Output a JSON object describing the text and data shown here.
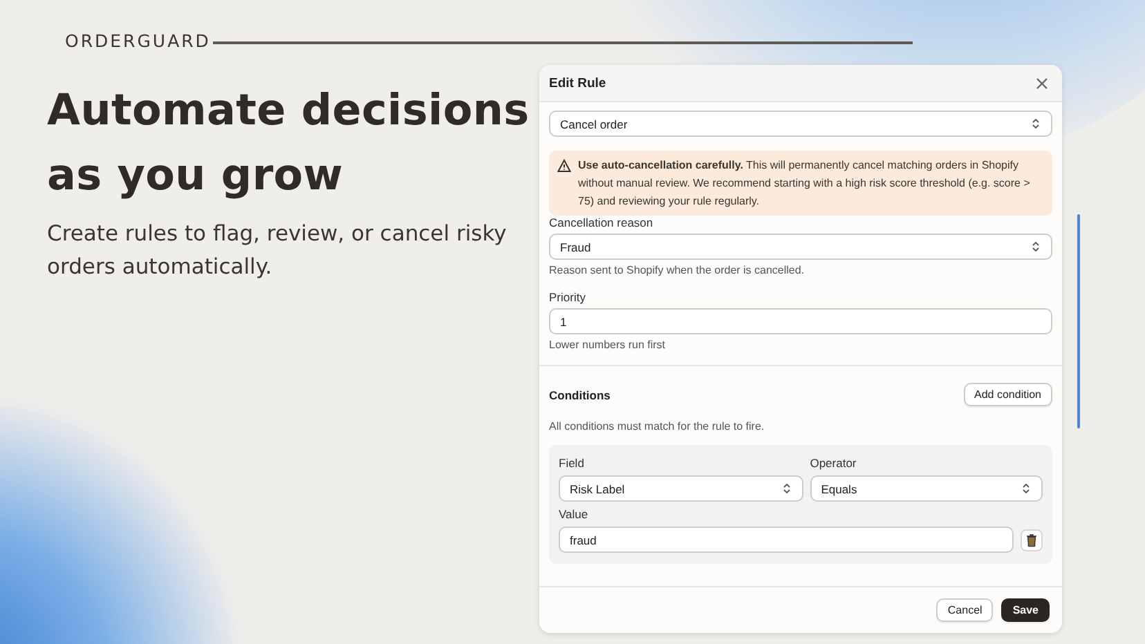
{
  "brand": "ORDERGUARD",
  "heading": "Automate decisions as you grow",
  "subheading": "Create rules to flag, review, or cancel risky orders automatically.",
  "modal": {
    "title": "Edit Rule",
    "action_select": {
      "value": "Cancel order"
    },
    "warning": "**Use auto-cancellation carefully.** This will permanently cancel matching orders in Shopify without manual review. We recommend starting with a high risk score threshold (e.g. score > 75) and reviewing your rule regularly.",
    "fields": [
      {
        "kind": "select",
        "label": "Cancellation reason",
        "value": "Fraud",
        "help": "Reason sent to Shopify when the order is cancelled."
      },
      {
        "kind": "text",
        "label": "Priority",
        "value": "1",
        "help": "Lower numbers run first"
      }
    ],
    "conditions": {
      "title": "Conditions",
      "add_button": "Add condition",
      "help": "All conditions must match for the rule to fire.",
      "field": {
        "label": "Field",
        "value": "Risk Label"
      },
      "operator": {
        "label": "Operator",
        "value": "Equals"
      },
      "value": {
        "label": "Value",
        "value": "fraud"
      }
    },
    "buttons": [
      {
        "label": "Cancel",
        "kind": "secondary"
      },
      {
        "label": "Save",
        "kind": "primary"
      }
    ]
  }
}
